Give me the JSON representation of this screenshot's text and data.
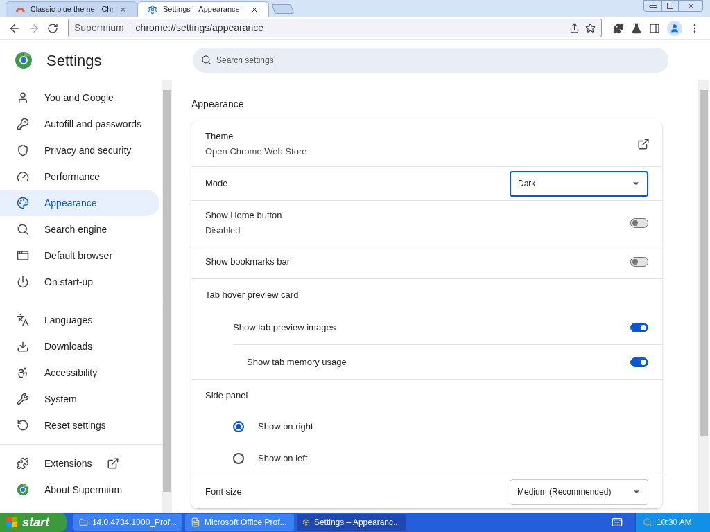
{
  "tabs": [
    {
      "title": "Classic blue theme - Chr",
      "selected": false
    },
    {
      "title": "Settings – Appearance",
      "selected": true
    }
  ],
  "address": {
    "prefix": "Supermium",
    "url": "chrome://settings/appearance"
  },
  "header": {
    "title": "Settings",
    "search_placeholder": "Search settings"
  },
  "sidebar": {
    "groups": [
      [
        {
          "label": "You and Google",
          "selected": false
        },
        {
          "label": "Autofill and passwords",
          "selected": false
        },
        {
          "label": "Privacy and security",
          "selected": false
        },
        {
          "label": "Performance",
          "selected": false
        },
        {
          "label": "Appearance",
          "selected": true
        },
        {
          "label": "Search engine",
          "selected": false
        },
        {
          "label": "Default browser",
          "selected": false
        },
        {
          "label": "On start-up",
          "selected": false
        }
      ],
      [
        {
          "label": "Languages",
          "selected": false
        },
        {
          "label": "Downloads",
          "selected": false
        },
        {
          "label": "Accessibility",
          "selected": false
        },
        {
          "label": "System",
          "selected": false
        },
        {
          "label": "Reset settings",
          "selected": false
        }
      ],
      [
        {
          "label": "Extensions",
          "selected": false,
          "external": true
        },
        {
          "label": "About Supermium",
          "selected": false
        }
      ]
    ]
  },
  "main": {
    "section_title": "Appearance",
    "rows": [
      {
        "kind": "link",
        "label": "Theme",
        "sublabel": "Open Chrome Web Store"
      },
      {
        "kind": "select",
        "label": "Mode",
        "value": "Dark",
        "focused": true
      },
      {
        "kind": "toggle",
        "label": "Show Home button",
        "sublabel": "Disabled",
        "on": false
      },
      {
        "kind": "toggle",
        "label": "Show bookmarks bar",
        "on": false
      },
      {
        "kind": "group",
        "label": "Tab hover preview card",
        "children": [
          {
            "kind": "toggle",
            "label": "Show tab preview images",
            "on": true
          },
          {
            "kind": "toggle",
            "label": "Show tab memory usage",
            "on": true
          }
        ]
      },
      {
        "kind": "group",
        "label": "Side panel",
        "children": [
          {
            "kind": "radio",
            "label": "Show on right",
            "selected": true
          },
          {
            "kind": "radio",
            "label": "Show on left",
            "selected": false
          }
        ]
      },
      {
        "kind": "select",
        "label": "Font size",
        "value": "Medium (Recommended)",
        "focused": false
      }
    ]
  },
  "taskbar": {
    "start": "start",
    "tasks": [
      {
        "label": "14.0.4734.1000_Prof...",
        "selected": false
      },
      {
        "label": "Microsoft Office Prof...",
        "selected": false
      },
      {
        "label": "Settings – Appearanc...",
        "selected": true
      }
    ],
    "clock": "10:30 AM"
  }
}
